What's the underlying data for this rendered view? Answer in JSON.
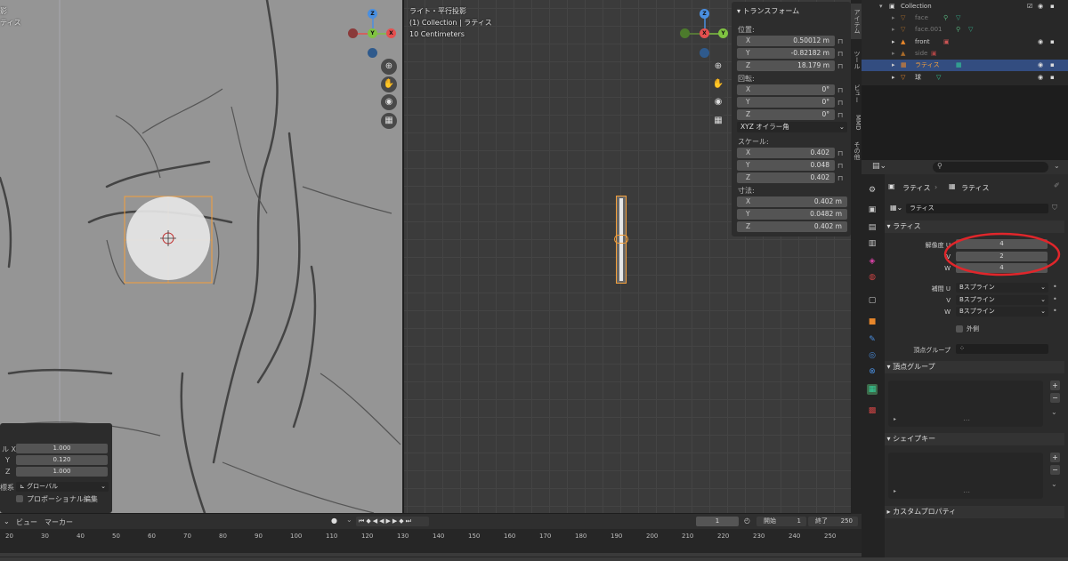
{
  "left_viewport": {
    "overlay_line1": "影",
    "overlay_line2": "ティス"
  },
  "right_viewport": {
    "view_name": "ライト・平行投影",
    "collection_line": "(1) Collection | ラティス",
    "scale": "10 Centimeters"
  },
  "gizmo": {
    "x": "X",
    "y": "Y",
    "z": "Z"
  },
  "transform_panel": {
    "title": "トランスフォーム",
    "location_label": "位置:",
    "location": [
      {
        "axis": "X",
        "value": "0.50012 m"
      },
      {
        "axis": "Y",
        "value": "-0.82182 m"
      },
      {
        "axis": "Z",
        "value": "18.179 m"
      }
    ],
    "rotation_label": "回転:",
    "rotation": [
      {
        "axis": "X",
        "value": "0°"
      },
      {
        "axis": "Y",
        "value": "0°"
      },
      {
        "axis": "Z",
        "value": "0°"
      }
    ],
    "rotation_mode": "XYZ オイラー角",
    "scale_label": "スケール:",
    "scale": [
      {
        "axis": "X",
        "value": "0.402"
      },
      {
        "axis": "Y",
        "value": "0.048"
      },
      {
        "axis": "Z",
        "value": "0.402"
      }
    ],
    "dimensions_label": "寸法:",
    "dimensions": [
      {
        "axis": "X",
        "value": "0.402 m"
      },
      {
        "axis": "Y",
        "value": "0.0482 m"
      },
      {
        "axis": "Z",
        "value": "0.402 m"
      }
    ]
  },
  "n_tabs": [
    "アイテム",
    "ツール",
    "ビュー",
    "MMD",
    "その他"
  ],
  "outliner": {
    "root": "Collection",
    "items": [
      {
        "name": "face",
        "dim": true
      },
      {
        "name": "face.001",
        "dim": true
      },
      {
        "name": "front",
        "dim": false
      },
      {
        "name": "side",
        "dim": true
      },
      {
        "name": "ラティス",
        "dim": false,
        "selected": true
      },
      {
        "name": "球",
        "dim": false
      }
    ]
  },
  "properties": {
    "search_placeholder": "",
    "breadcrumb_object": "ラティス",
    "breadcrumb_data": "ラティス",
    "datablock_name": "ラティス",
    "lattice_section": "ラティス",
    "resolution_label": "解像度 U",
    "resolution_u": "4",
    "resolution_v_label": "V",
    "resolution_v": "2",
    "resolution_w_label": "W",
    "resolution_w": "4",
    "interp_label": "補間 U",
    "interp_u": "Bスプライン",
    "interp_v_label": "V",
    "interp_v": "Bスプライン",
    "interp_w_label": "W",
    "interp_w": "Bスプライン",
    "outside_label": "外側",
    "vertex_group_label": "頂点グループ",
    "vertex_groups_section": "頂点グループ",
    "shape_keys_section": "シェイプキー",
    "custom_props_section": "カスタムプロパティ"
  },
  "operator_panel": {
    "rows": [
      {
        "axis": "ル X",
        "value": "1.000"
      },
      {
        "axis": "Y",
        "value": "0.120"
      },
      {
        "axis": "Z",
        "value": "1.000"
      }
    ],
    "orientation_label": "標系",
    "orientation_value": "グローバル",
    "proportional_label": "プロポーショナル編集"
  },
  "timeline": {
    "menu_view": "ビュー",
    "menu_marker": "マーカー",
    "current_frame": "1",
    "start_label": "開始",
    "start": "1",
    "end_label": "終了",
    "end": "250",
    "ticks": [
      "20",
      "30",
      "40",
      "50",
      "60",
      "70",
      "80",
      "90",
      "100",
      "110",
      "120",
      "130",
      "140",
      "150",
      "160",
      "170",
      "180",
      "190",
      "200",
      "210",
      "220",
      "230",
      "240",
      "250"
    ]
  },
  "colors": {
    "accent": "#f5a03b",
    "annotation": "#e0262b",
    "selected_row": "#334d80",
    "x_axis": "#e5504f",
    "y_axis": "#7fc241",
    "z_axis": "#4a8fe0"
  }
}
